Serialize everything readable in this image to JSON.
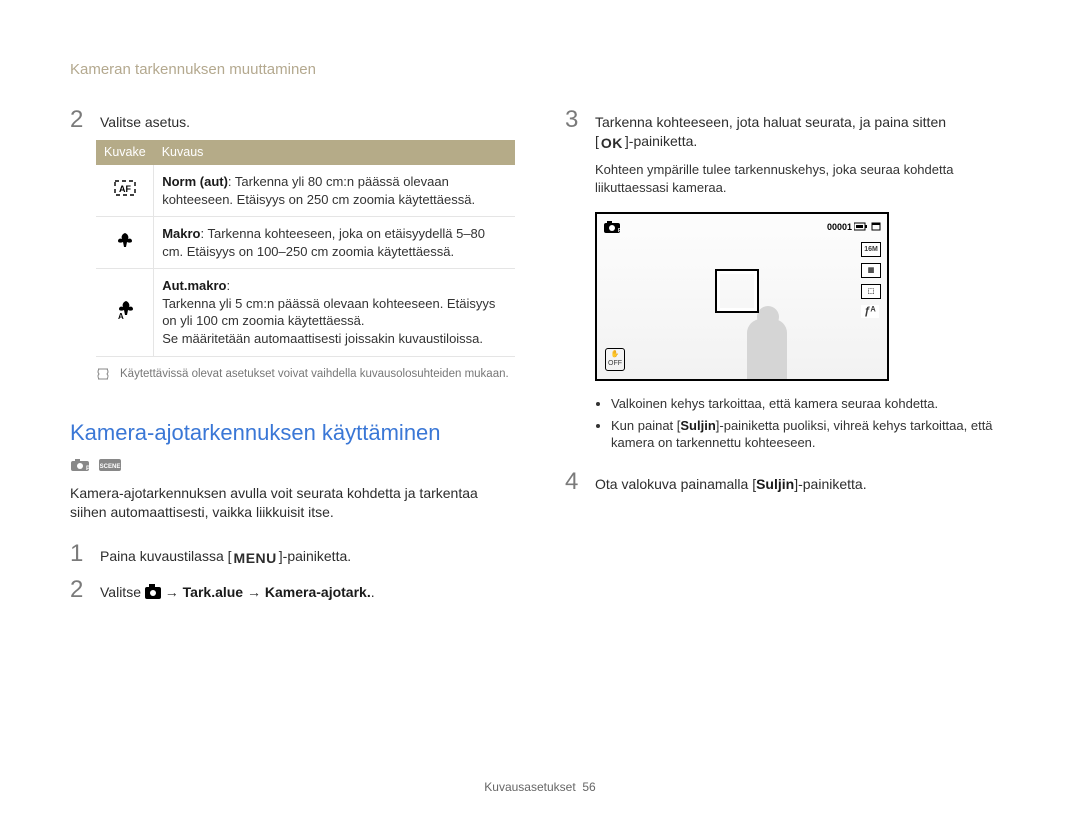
{
  "header": {
    "breadcrumb": "Kameran tarkennuksen muuttaminen"
  },
  "left": {
    "step2_label": "Valitse asetus.",
    "table": {
      "head_icon": "Kuvake",
      "head_desc": "Kuvaus",
      "rows": [
        {
          "icon": "af-normal",
          "bold": "Norm (aut)",
          "text": ": Tarkenna yli 80 cm:n päässä olevaan kohteeseen. Etäisyys on 250 cm zoomia käytettäessä."
        },
        {
          "icon": "macro",
          "bold": "Makro",
          "text": ": Tarkenna kohteeseen, joka on etäisyydellä 5–80 cm. Etäisyys on 100–250 cm zoomia käytettäessä."
        },
        {
          "icon": "auto-macro",
          "bold": "Aut.makro",
          "text": ":\nTarkenna yli 5 cm:n päässä olevaan kohteeseen. Etäisyys on yli 100 cm zoomia käytettäessä.\nSe määritetään automaattisesti joissakin kuvaustiloissa."
        }
      ]
    },
    "note": "Käytettävissä olevat asetukset voivat vaihdella kuvausolosuhteiden mukaan.",
    "section_title": "Kamera-ajotarkennuksen käyttäminen",
    "section_desc": "Kamera-ajotarkennuksen avulla voit seurata kohdetta ja tarkentaa siihen automaattisesti, vaikka liikkuisit itse.",
    "step1_pre": "Paina kuvaustilassa [",
    "step1_post": "]-painiketta.",
    "step1_menu": "MENU",
    "step2b_pre": "Valitse ",
    "step2b_arrow": " → ",
    "step2b_a": "Tark.alue",
    "step2b_b": "Kamera-ajotark.",
    "step2b_suffix": "."
  },
  "right": {
    "step3_line1": "Tarkenna kohteeseen, jota haluat seurata, ja paina sitten",
    "step3_ok": "OK",
    "step3_line2": "]-painiketta.",
    "step3_sub": "Kohteen ympärille tulee tarkennuskehys, joka seuraa kohdetta liikuttaessasi kameraa.",
    "viewfinder": {
      "counter": "00001",
      "ind": [
        "16M",
        "▦",
        "⬚",
        "ƒᴬ"
      ],
      "ois": "✋\nOFF"
    },
    "vf_notes": [
      "Valkoinen kehys tarkoittaa, että kamera seuraa kohdetta.",
      "Kun painat [Suljin]-painiketta puoliksi, vihreä kehys tarkoittaa, että kamera on tarkennettu kohteeseen."
    ],
    "step4_pre": "Ota valokuva painamalla [",
    "step4_btn": "Suljin",
    "step4_post": "]-painiketta."
  },
  "footer": {
    "section": "Kuvausasetukset",
    "page": "56"
  },
  "step_numbers": {
    "n1": "1",
    "n2": "2",
    "n3": "3",
    "n4": "4"
  }
}
